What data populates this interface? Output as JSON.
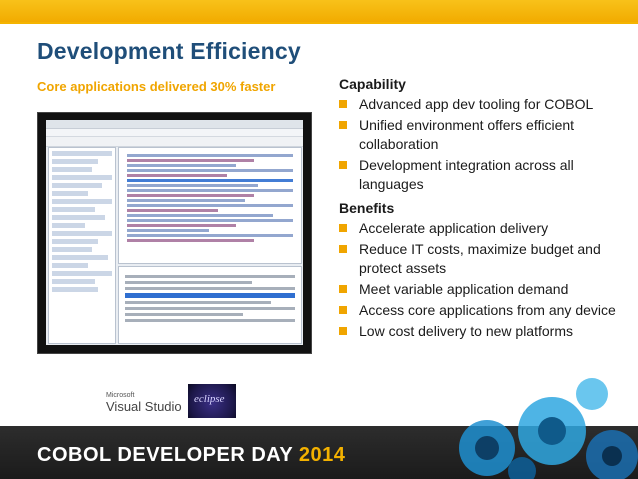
{
  "title": "Development Efficiency",
  "subtitle": "Core applications delivered 30% faster",
  "capability": {
    "heading": "Capability",
    "items": [
      "Advanced app dev tooling for COBOL",
      "Unified environment offers efficient collaboration",
      "Development integration across all languages"
    ]
  },
  "benefits": {
    "heading": "Benefits",
    "items": [
      "Accelerate application delivery",
      "Reduce IT costs, maximize budget and protect assets",
      "Meet variable application demand",
      "Access core applications from any device",
      "Low cost delivery to new platforms"
    ]
  },
  "logos": {
    "visual_studio_small": "Microsoft",
    "visual_studio": "Visual Studio",
    "eclipse": "eclipse"
  },
  "footer": {
    "text": "COBOL DEVELOPER DAY",
    "year": "2014"
  },
  "colors": {
    "accent": "#f0a500",
    "title": "#1f4e79",
    "footer_bg": "#222222"
  }
}
